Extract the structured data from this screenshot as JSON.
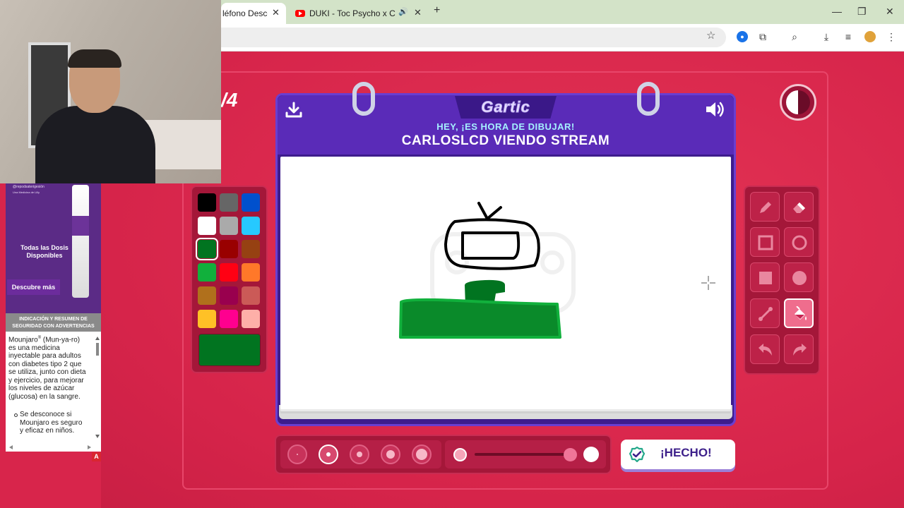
{
  "browser": {
    "tabs": [
      {
        "title": "léfono Descon",
        "active": true
      },
      {
        "title": "DUKI - Toc Psycho x CRYPTO",
        "playing_audio": true
      }
    ],
    "new_tab": "+",
    "window_controls": {
      "minimize": "—",
      "restore": "❐",
      "close": "✕"
    }
  },
  "ad": {
    "banner_small_1": "@repodsaterigesión",
    "banner_small_2": "Una Medicina de Lilly",
    "headline": "Todas las Dosis Disponibles",
    "cta": "Descubre más",
    "warning_header": "INDICACIÓN Y RESUMEN DE SEGURIDAD CON ADVERTENCIAS",
    "body_brand": "Mounjaro",
    "body_sup": "®",
    "body_text": " (Mun-ya-ro) es una medicina inyectable para adultos con diabetes tipo 2 que se utiliza, junto con dieta y ejercicio, para mejorar los niveles de azúcar (glucosa) en la sangre.",
    "bullet": "Se desconoce si Mounjaro es seguro y eficaz en niños.",
    "adchoice": "A"
  },
  "game": {
    "round": "/4",
    "logo": "Gartic",
    "prompt": "HEY, ¡ES HORA DE DIBUJAR!",
    "word": "CARLOSLCD VIENDO STREAM",
    "done_label": "¡HECHO!",
    "palette": [
      "#000000",
      "#666666",
      "#0050cd",
      "#ffffff",
      "#aaaaaa",
      "#26c9ff",
      "#017420",
      "#990000",
      "#964112",
      "#11b03c",
      "#ff0013",
      "#ff7829",
      "#b0701c",
      "#99004e",
      "#cb5a57",
      "#ffc126",
      "#ff008f",
      "#feafa8"
    ],
    "selected_color": "#017420",
    "tools": [
      "pencil-tool",
      "eraser-tool",
      "rect-outline-tool",
      "ellipse-outline-tool",
      "rect-fill-tool",
      "ellipse-fill-tool",
      "line-tool",
      "bucket-tool",
      "undo-tool",
      "redo-tool"
    ],
    "active_tool": "bucket-tool",
    "brush_sizes": 5,
    "active_size": 2,
    "opacity": 0.9
  }
}
